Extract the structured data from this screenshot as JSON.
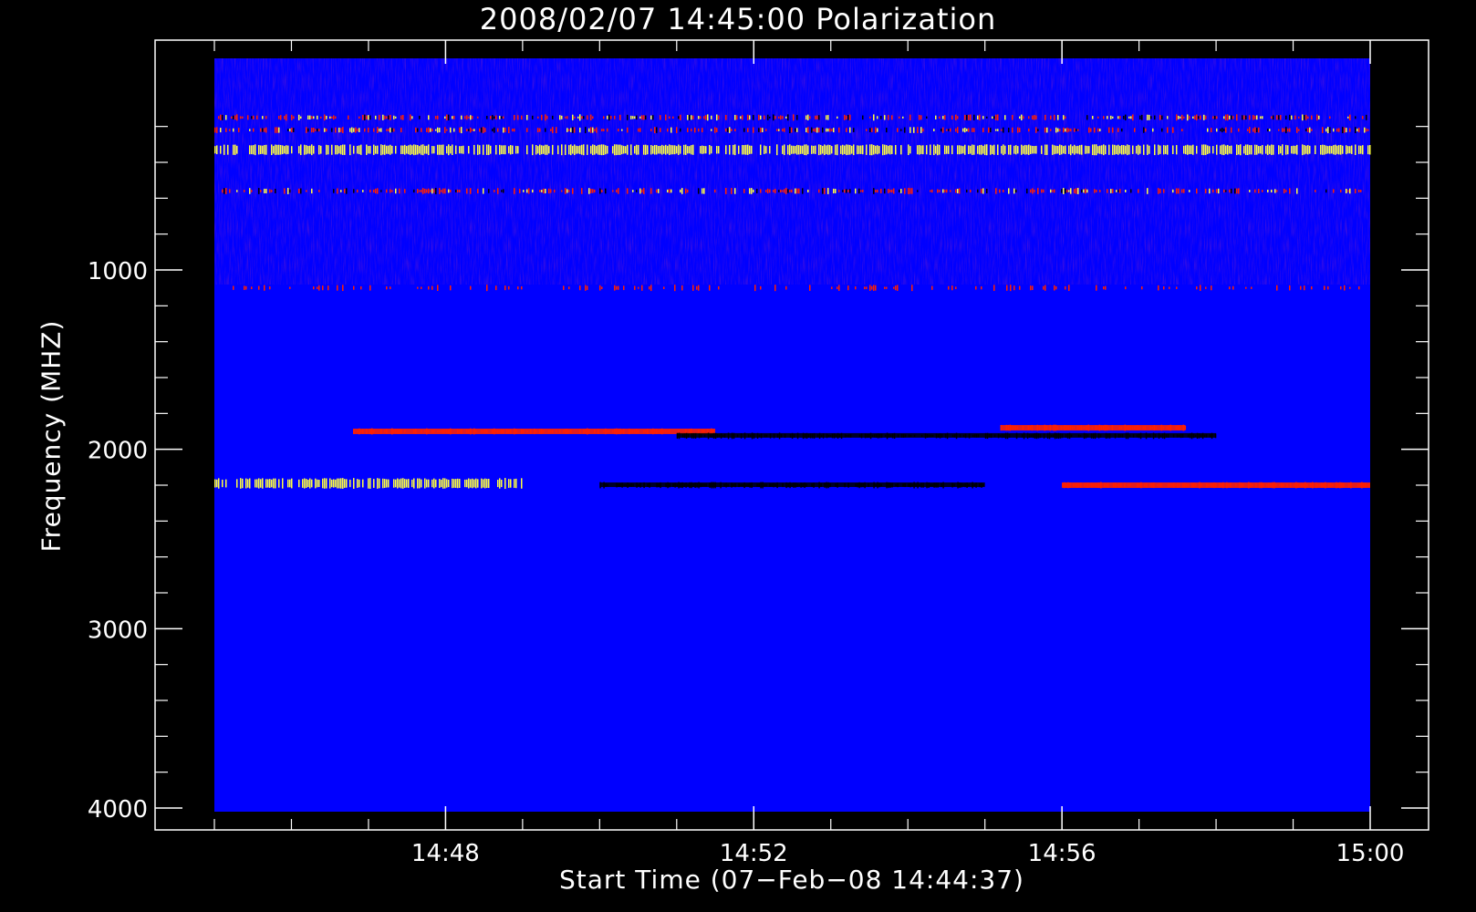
{
  "chart_data": {
    "type": "heatmap",
    "title": "2008/02/07 14:45:00 Polarization",
    "xlabel": "Start Time (07−Feb−08 14:44:37)",
    "ylabel": "Frequency (MHZ)",
    "x_axis": {
      "ticks": [
        {
          "value": "14:48",
          "minutes": 48
        },
        {
          "value": "14:52",
          "minutes": 52
        },
        {
          "value": "14:56",
          "minutes": 56
        },
        {
          "value": "15:00",
          "minutes": 60
        }
      ],
      "range_minutes": [
        45,
        60
      ]
    },
    "y_axis": {
      "reversed": true,
      "ticks": [
        1000,
        2000,
        3000,
        4000
      ],
      "range_mhz": [
        100,
        4000
      ]
    },
    "colormap": {
      "background": "#0000ff",
      "hot": "#ff2000",
      "bright": "#ffff40",
      "dark": "#000000"
    },
    "features": [
      {
        "freq_mhz": 150,
        "kind": "noisy",
        "extent_minutes": [
          45,
          60
        ]
      },
      {
        "freq_mhz": 220,
        "kind": "noisy",
        "extent_minutes": [
          45,
          60
        ]
      },
      {
        "freq_mhz": 330,
        "kind": "bright",
        "extent_minutes": [
          45,
          60
        ]
      },
      {
        "freq_mhz": 560,
        "kind": "noisy",
        "extent_minutes": [
          45,
          60
        ]
      },
      {
        "freq_mhz": 1100,
        "kind": "sparse",
        "extent_minutes": [
          45,
          60
        ]
      },
      {
        "freq_mhz": 1900,
        "kind": "hot",
        "extent_minutes": [
          46.8,
          51.5
        ]
      },
      {
        "freq_mhz": 1925,
        "kind": "dark",
        "extent_minutes": [
          51,
          58
        ]
      },
      {
        "freq_mhz": 1880,
        "kind": "hot",
        "extent_minutes": [
          55.2,
          57.6
        ]
      },
      {
        "freq_mhz": 2190,
        "kind": "bright",
        "extent_minutes": [
          45,
          49
        ]
      },
      {
        "freq_mhz": 2200,
        "kind": "dark",
        "extent_minutes": [
          50,
          55
        ]
      },
      {
        "freq_mhz": 2200,
        "kind": "hot",
        "extent_minutes": [
          56,
          60
        ]
      }
    ]
  }
}
